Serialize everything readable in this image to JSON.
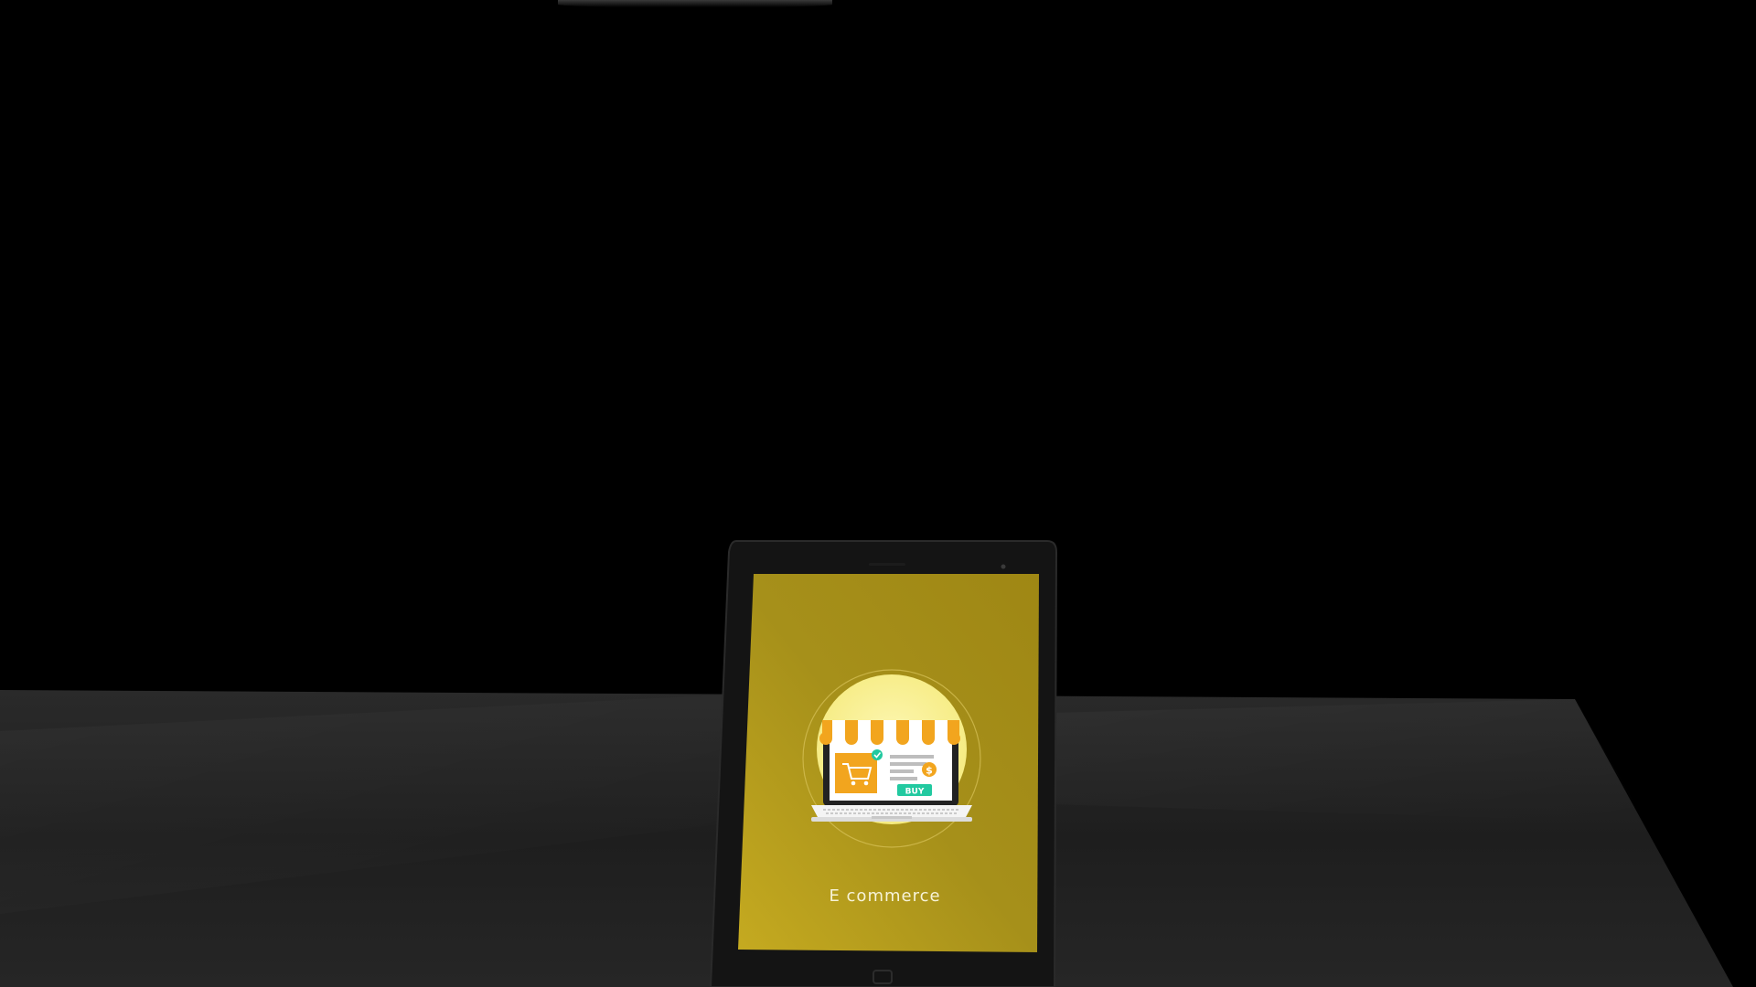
{
  "scene": {
    "background": "#000000",
    "table_color": "#242424"
  },
  "tablet": {
    "screen_title": "E commerce",
    "screen_color": "#b39b18",
    "illustration": {
      "icon": "laptop-storefront-icon",
      "buy_label": "BUY",
      "currency_symbol": "$",
      "awning_colors": [
        "#f2a51e",
        "#ffffff"
      ],
      "glow_color": "#fbf29a",
      "buy_color": "#22c9a0"
    }
  }
}
